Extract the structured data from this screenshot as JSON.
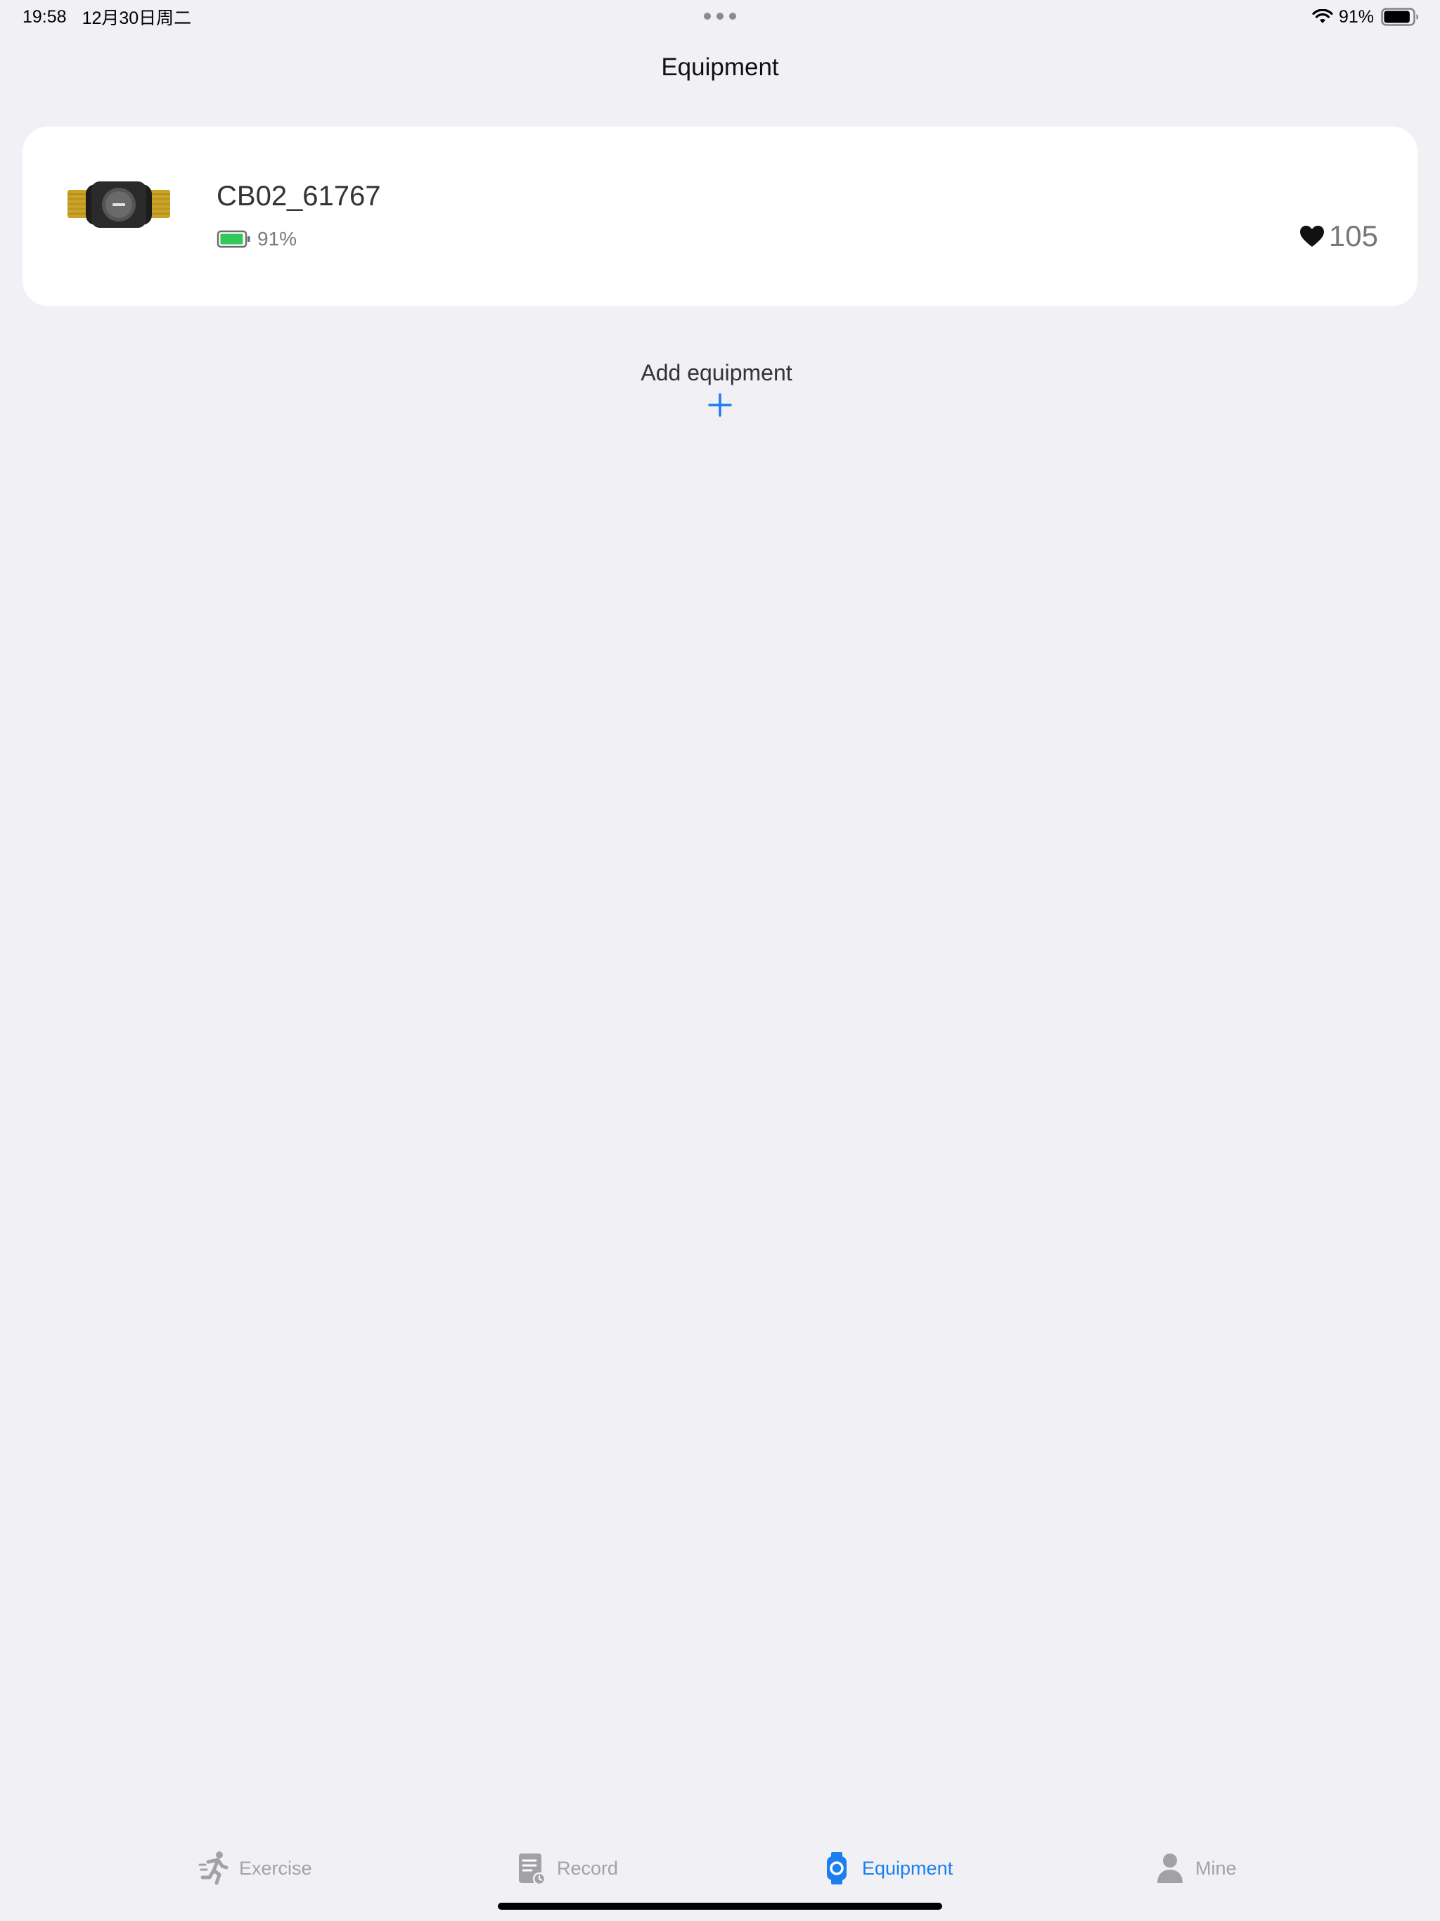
{
  "status_bar": {
    "time": "19:58",
    "date": "12月30日周二",
    "battery_percent": "91%",
    "battery_level": 0.91
  },
  "nav": {
    "title": "Equipment"
  },
  "device": {
    "name": "CB02_61767",
    "battery": "91%",
    "battery_level": 0.91,
    "battery_color": "#34c759",
    "heart_rate": "105"
  },
  "add_equipment": {
    "label": "Add equipment"
  },
  "tab_bar": {
    "active_color": "#1a7ff0",
    "inactive_color": "#a2a2a6",
    "tabs": [
      {
        "label": "Exercise",
        "icon": "running-icon"
      },
      {
        "label": "Record",
        "icon": "record-icon"
      },
      {
        "label": "Equipment",
        "icon": "watch-icon",
        "active": true
      },
      {
        "label": "Mine",
        "icon": "person-icon"
      }
    ]
  }
}
